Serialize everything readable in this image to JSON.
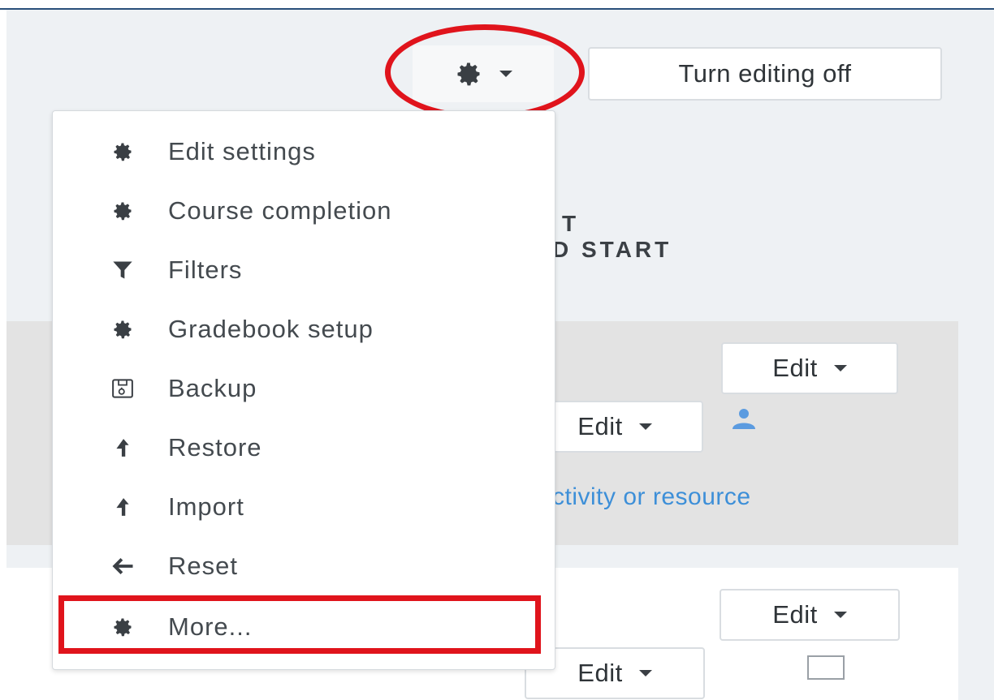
{
  "header": {
    "turn_editing_label": "Turn editing off"
  },
  "course": {
    "title_line1": "T",
    "title_line2": "D START"
  },
  "sections": {
    "edit_label": "Edit",
    "add_activity_text": "ctivity or resource"
  },
  "menu": {
    "items": [
      {
        "label": "Edit settings",
        "icon": "gear-icon"
      },
      {
        "label": "Course completion",
        "icon": "gear-icon"
      },
      {
        "label": "Filters",
        "icon": "filter-icon"
      },
      {
        "label": "Gradebook setup",
        "icon": "gear-icon"
      },
      {
        "label": "Backup",
        "icon": "backup-icon"
      },
      {
        "label": "Restore",
        "icon": "upload-icon"
      },
      {
        "label": "Import",
        "icon": "upload-icon"
      },
      {
        "label": "Reset",
        "icon": "arrow-left-icon"
      },
      {
        "label": "More...",
        "icon": "gear-icon"
      }
    ]
  },
  "colors": {
    "highlight": "#e0141c",
    "link": "#3d8fd8",
    "accent_blue": "#5b9be0"
  }
}
